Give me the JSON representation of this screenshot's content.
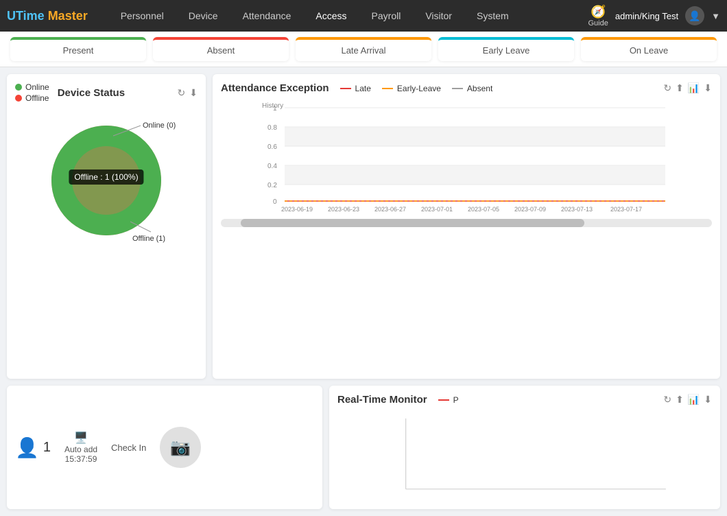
{
  "navbar": {
    "logo": {
      "u": "U",
      "time": "Time",
      "master": " Master"
    },
    "nav_items": [
      {
        "label": "Personnel",
        "id": "personnel"
      },
      {
        "label": "Device",
        "id": "device"
      },
      {
        "label": "Attendance",
        "id": "attendance"
      },
      {
        "label": "Access",
        "id": "access"
      },
      {
        "label": "Payroll",
        "id": "payroll"
      },
      {
        "label": "Visitor",
        "id": "visitor"
      },
      {
        "label": "System",
        "id": "system"
      }
    ],
    "guide_label": "Guide",
    "user_label": "admin/King Test"
  },
  "status_cards": [
    {
      "label": "Present",
      "class": "present"
    },
    {
      "label": "Absent",
      "class": "absent"
    },
    {
      "label": "Late Arrival",
      "class": "late"
    },
    {
      "label": "Early Leave",
      "class": "early-leave"
    },
    {
      "label": "On Leave",
      "class": "on-leave"
    }
  ],
  "device_status": {
    "title": "Device Status",
    "legend_online": "Online",
    "legend_offline": "Offline",
    "label_online": "Online (0)",
    "label_offline": "Offline (1)",
    "tooltip": "Offline : 1 (100%)"
  },
  "attendance_exception": {
    "title": "Attendance Exception",
    "legend_late": "Late",
    "legend_early_leave": "Early-Leave",
    "legend_absent": "Absent",
    "y_label": "History",
    "y_values": [
      "1",
      "0.8",
      "0.6",
      "0.4",
      "0.2",
      "0"
    ],
    "x_dates": [
      "2023-06-19",
      "2023-06-23",
      "2023-06-27",
      "2023-07-01",
      "2023-07-05",
      "2023-07-09",
      "2023-07-13",
      "2023-07-17"
    ]
  },
  "checkin": {
    "user_count": "1",
    "auto_add_label": "Auto add",
    "auto_add_time": "15:37:59",
    "check_in_label": "Check In"
  },
  "realtime_monitor": {
    "title": "Real-Time Monitor",
    "legend_p": "P"
  }
}
